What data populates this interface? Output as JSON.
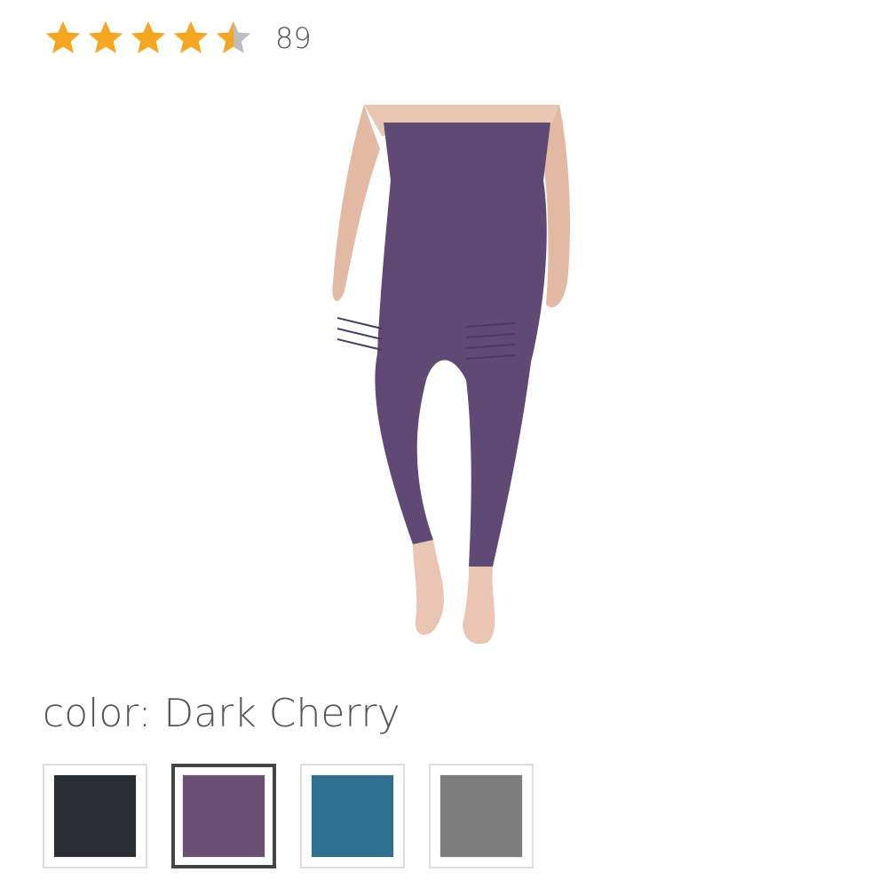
{
  "rating": {
    "stars": 4.5,
    "max": 5,
    "count": "89",
    "star_color": "#f5a623",
    "empty_color": "#bdbdbd"
  },
  "product": {
    "image_icon": "leggings-product-image",
    "garment_color": "#5e4a74"
  },
  "color": {
    "label": "color: Dark Cherry",
    "swatches": [
      {
        "name": "black",
        "hex": "#2b2e33",
        "selected": false
      },
      {
        "name": "dark-cherry",
        "hex": "#6b4f75",
        "selected": true
      },
      {
        "name": "teal",
        "hex": "#2f6f8f",
        "selected": false
      },
      {
        "name": "gray",
        "hex": "#7d7d7d",
        "selected": false
      }
    ]
  }
}
